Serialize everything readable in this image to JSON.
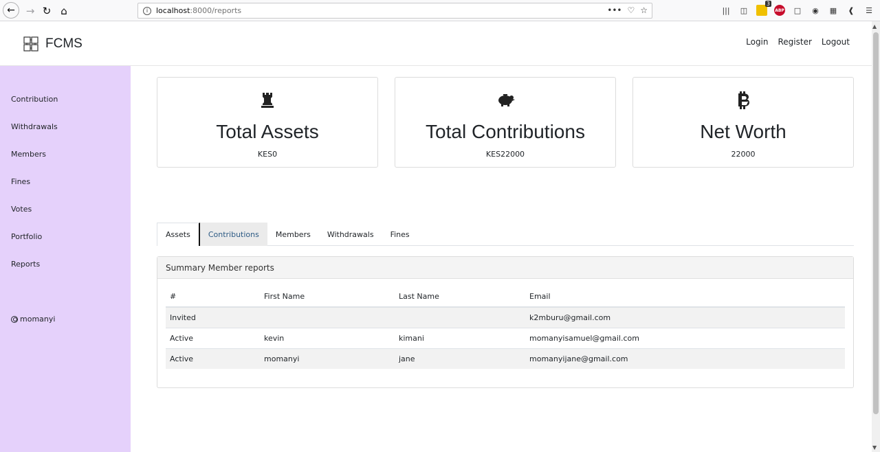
{
  "browser": {
    "url_host": "localhost",
    "url_port_path": ":8000/reports",
    "url_actions": [
      "•••",
      "♡",
      "☆"
    ],
    "badge_count": "3",
    "abp_label": "ABP"
  },
  "app": {
    "brand": "FCMS",
    "top_nav": {
      "login": "Login",
      "register": "Register",
      "logout": "Logout"
    }
  },
  "sidebar": {
    "items": [
      {
        "label": "Contribution"
      },
      {
        "label": "Withdrawals"
      },
      {
        "label": "Members"
      },
      {
        "label": "Fines"
      },
      {
        "label": "Votes"
      },
      {
        "label": "Portfolio"
      },
      {
        "label": "Reports"
      }
    ],
    "user": "momanyi"
  },
  "cards": [
    {
      "icon": "chess-rook-icon",
      "title": "Total Assets",
      "value": "KES0"
    },
    {
      "icon": "piggy-bank-icon",
      "title": "Total Contributions",
      "value": "KES22000"
    },
    {
      "icon": "bitcoin-icon",
      "title": "Net Worth",
      "value": "22000"
    }
  ],
  "tabs": [
    {
      "label": "Assets"
    },
    {
      "label": "Contributions"
    },
    {
      "label": "Members"
    },
    {
      "label": "Withdrawals"
    },
    {
      "label": "Fines"
    }
  ],
  "panel": {
    "title": "Summary Member reports",
    "columns": [
      "#",
      "First Name",
      "Last Name",
      "Email"
    ],
    "rows": [
      {
        "status": "Invited",
        "first": "",
        "last": "",
        "email": "k2mburu@gmail.com"
      },
      {
        "status": "Active",
        "first": "kevin",
        "last": "kimani",
        "email": "momanyisamuel@gmail.com"
      },
      {
        "status": "Active",
        "first": "momanyi",
        "last": "jane",
        "email": "momanyijane@gmail.com"
      }
    ]
  },
  "colors": {
    "sidebar_bg": "#e5d1fb",
    "active_tab_text": "#2c5a84"
  }
}
